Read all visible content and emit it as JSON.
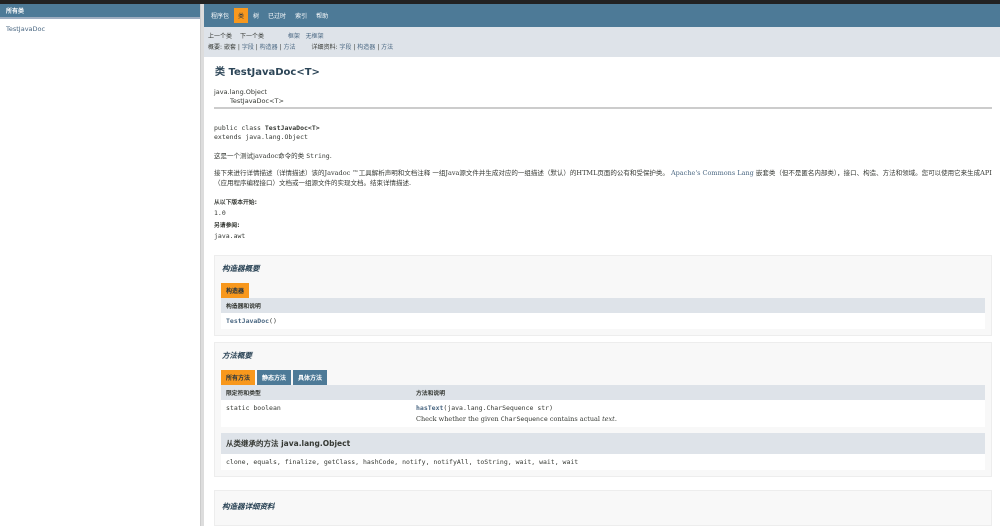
{
  "left": {
    "header": "所有类",
    "items": [
      "TestJavaDoc"
    ]
  },
  "nav": {
    "items": [
      "程序包",
      "类",
      "树",
      "已过时",
      "索引",
      "帮助"
    ],
    "active": 1
  },
  "subnav": {
    "prev": "上一个类",
    "next": "下一个类",
    "frames": "框架",
    "no_frames": "无框架",
    "summary_label": "概要:",
    "summary": [
      "嵌套",
      "字段",
      "构造器",
      "方法"
    ],
    "detail_label": "详细资料:",
    "detail": [
      "字段",
      "构造器",
      "方法"
    ]
  },
  "title": "类 TestJavaDoc<T>",
  "inheritance": [
    "java.lang.Object",
    "TestJavaDoc<T>"
  ],
  "declaration": {
    "line1_prefix": "public class ",
    "line1_name": "TestJavaDoc<T>",
    "line2": "extends java.lang.Object"
  },
  "desc1": {
    "text": "这是一个测试javadoc命令的类 ",
    "code": "String",
    "end": "."
  },
  "desc2": {
    "before": "接下来进行详情描述（详情描述）该的Javadoc ™工具解析声明和文档注释 一组Java源文件并生成对应的一组描述（默认）的HTML页面的公有和受保护类。 ",
    "link": "Apache's Commons Lang",
    "after": " 嵌套类（但不是匿名内部类），接口、构造、方法和领域。您可以使用它来生成API （应用程序编程接口）文档或一组源文件的实现文档。结束详情描述."
  },
  "since_label": "从以下版本开始:",
  "since": "1.0",
  "see_label": "另请参阅:",
  "see": "java.awt",
  "ctor_summary": {
    "title": "构造器概要",
    "tab": "构造器",
    "header": "构造器和说明",
    "row": "TestJavaDoc",
    "row_args": "()"
  },
  "method_summary": {
    "title": "方法概要",
    "tabs": [
      "所有方法",
      "静态方法",
      "具体方法"
    ],
    "headers": [
      "限定符和类型",
      "方法和说明"
    ],
    "rows": [
      {
        "type": "static boolean",
        "name": "hasText",
        "args": "(java.lang.CharSequence str)",
        "desc_before": "Check whether the given ",
        "desc_code": "CharSequence",
        "desc_after": " contains actual ",
        "desc_em": "text",
        "desc_end": "."
      }
    ],
    "inherited_title": "从类继承的方法 java.lang.Object",
    "inherited": "clone, equals, finalize, getClass, hashCode, notify, notifyAll, toString, wait, wait, wait"
  },
  "ctor_detail": {
    "title": "构造器详细资料"
  }
}
